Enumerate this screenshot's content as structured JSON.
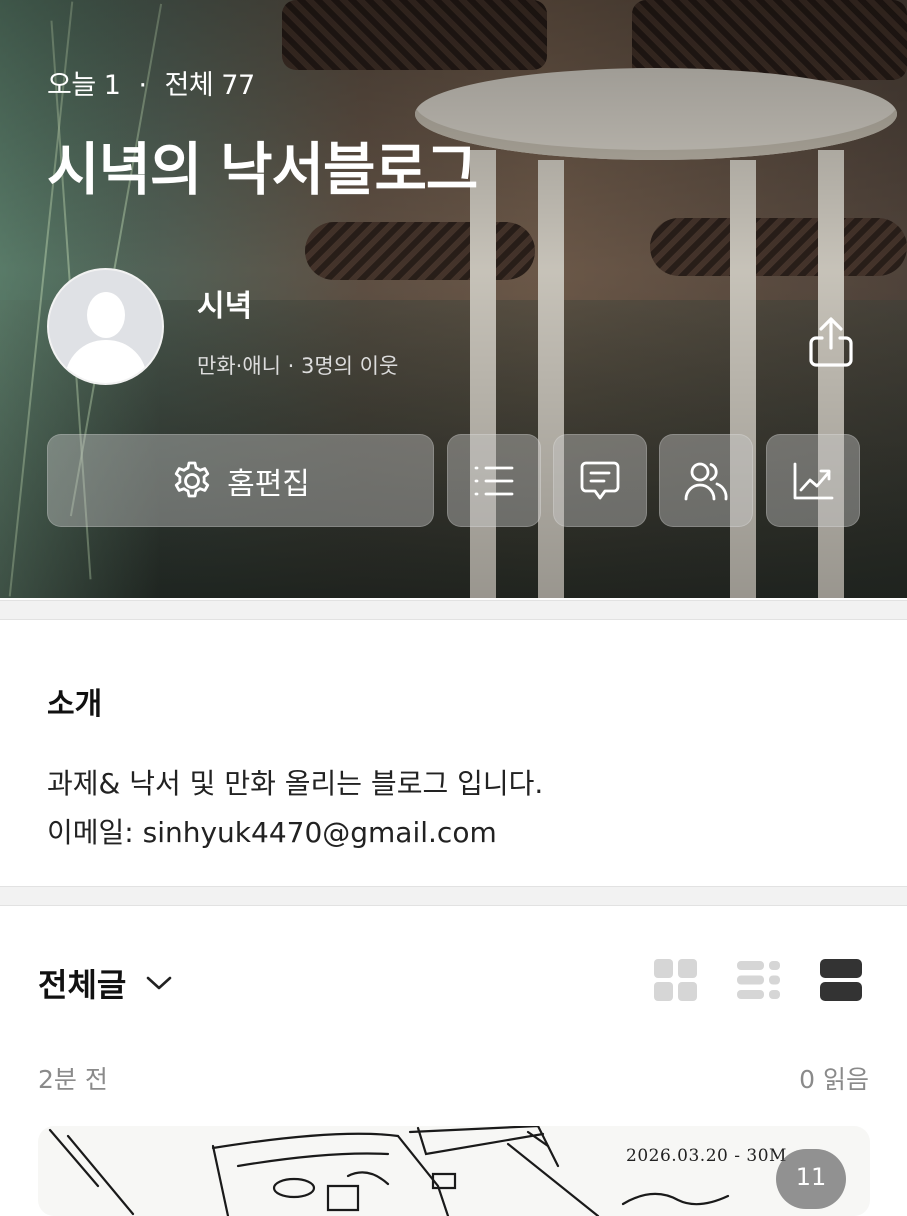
{
  "header": {
    "today_label": "오늘 1",
    "separator": "·",
    "total_label": "전체 77",
    "title": "시녁의 낙서블로그",
    "owner_name": "시녁",
    "owner_meta": "만화·애니 · 3명의 이웃"
  },
  "actions": {
    "edit_label": "홈편집",
    "icons": [
      "gear-icon",
      "list-icon",
      "comment-icon",
      "neighbors-icon",
      "stats-icon",
      "share-icon"
    ]
  },
  "intro": {
    "heading": "소개",
    "line1": "과제& 낙서 및 만화 올리는 블로그 입니다.",
    "line2": "이메일: sinhyuk4470@gmail.com"
  },
  "posts": {
    "filter_label": "전체글",
    "view_modes": [
      "grid-view-icon",
      "list-view-icon",
      "card-view-icon"
    ],
    "active_view": "card-view-icon",
    "first_post": {
      "time": "2분 전",
      "reads": "0 읽음",
      "image_count": "11",
      "sketch_date": "2026.03.20 - 30M"
    }
  },
  "colors": {
    "accent_text": "#111111",
    "muted_text": "#8a8a8a",
    "active_view_icon": "#333333",
    "inactive_view_icon": "#d6d6d6"
  }
}
